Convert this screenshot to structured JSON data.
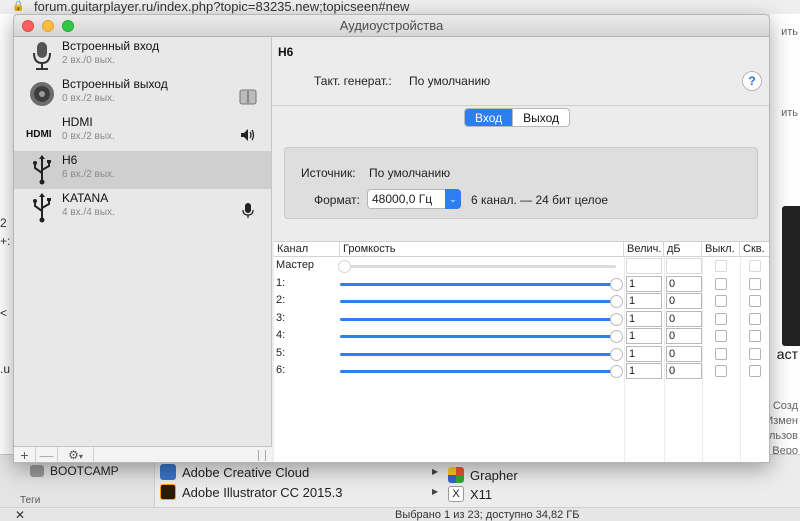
{
  "browser": {
    "url_main": "forum.guitarplayer.ru/index.php?topic=83235.new;topicseen#new",
    "right_snippets": [
      "ить",
      "ить",
      "аст",
      "Созд",
      "Измен",
      "льзов",
      "Веро"
    ],
    "left_snippets": [
      "2",
      "+:",
      "<",
      ".u"
    ]
  },
  "finder": {
    "sidebar_items": [
      {
        "label": "BOOTCAMP"
      },
      {
        "label": "Теги"
      }
    ],
    "apps": [
      {
        "label": "Adobe Creative Cloud",
        "color": "#3a74c9"
      },
      {
        "label": "Adobe Illustrator CC 2015.3",
        "color": "#2b1b04"
      }
    ],
    "apps_right": [
      {
        "label": "Grapher"
      },
      {
        "label": "X11"
      }
    ],
    "status": "Выбрано 1 из 23; доступно 34,82 ГБ"
  },
  "window": {
    "title": "Аудиоустройства"
  },
  "devices": [
    {
      "name": "Встроенный вход",
      "sub": "2 вх./0 вых.",
      "icon": "microphone-icon",
      "badge": ""
    },
    {
      "name": "Встроенный выход",
      "sub": "0 вх./2 вых.",
      "icon": "speaker-icon",
      "badge": "finder-icon"
    },
    {
      "name": "HDMI",
      "sub": "0 вх./2 вых.",
      "icon": "hdmi-icon",
      "badge": "speaker-volume-icon"
    },
    {
      "name": "H6",
      "sub": "6 вх./2 вых.",
      "icon": "usb-icon",
      "badge": "",
      "selected": true
    },
    {
      "name": "KATANA",
      "sub": "4 вх./4 вых.",
      "icon": "usb-icon",
      "badge": "microphone-small-icon"
    }
  ],
  "sidebar_footer": {
    "add": "+",
    "remove": "—",
    "gear": "⚙"
  },
  "detail": {
    "device_title": "H6",
    "clock_label": "Такт. генерат.:",
    "clock_value": "По умолчанию",
    "help": "?",
    "tabs": {
      "input": "Вход",
      "output": "Выход",
      "active": "input"
    },
    "source_label": "Источник:",
    "source_value": "По умолчанию",
    "format_label": "Формат:",
    "format_value": "48000,0 Гц",
    "format_desc": "6 канал. — 24 бит целое"
  },
  "table": {
    "headers": {
      "channel": "Канал",
      "volume": "Громкость",
      "value": "Велич.",
      "db": "дБ",
      "mute": "Выкл.",
      "thru": "Скв."
    },
    "rows": [
      {
        "channel": "Мастер",
        "value": "",
        "db": "",
        "enabled": false,
        "level": 0
      },
      {
        "channel": "1:",
        "value": "1",
        "db": "0",
        "enabled": true,
        "level": 1
      },
      {
        "channel": "2:",
        "value": "1",
        "db": "0",
        "enabled": true,
        "level": 1
      },
      {
        "channel": "3:",
        "value": "1",
        "db": "0",
        "enabled": true,
        "level": 1
      },
      {
        "channel": "4:",
        "value": "1",
        "db": "0",
        "enabled": true,
        "level": 1
      },
      {
        "channel": "5:",
        "value": "1",
        "db": "0",
        "enabled": true,
        "level": 1
      },
      {
        "channel": "6:",
        "value": "1",
        "db": "0",
        "enabled": true,
        "level": 1
      }
    ]
  },
  "colors": {
    "accent": "#2e7ef0",
    "selection": "#cfcfcf"
  }
}
